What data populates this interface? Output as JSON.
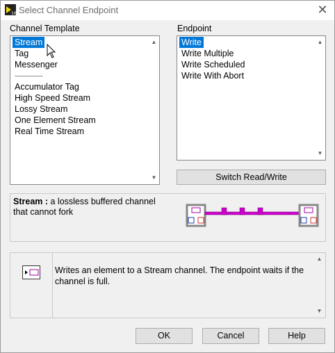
{
  "window": {
    "title": "Select Channel Endpoint",
    "close_glyph": "✕"
  },
  "template": {
    "label": "Channel Template",
    "items": [
      {
        "label": "Stream",
        "selected": true
      },
      {
        "label": "Tag"
      },
      {
        "label": "Messenger"
      },
      {
        "label": "-----------",
        "separator": true
      },
      {
        "label": "Accumulator Tag"
      },
      {
        "label": "High Speed Stream"
      },
      {
        "label": "Lossy Stream"
      },
      {
        "label": "One Element Stream"
      },
      {
        "label": "Real Time Stream"
      }
    ]
  },
  "endpoint": {
    "label": "Endpoint",
    "items": [
      {
        "label": "Write",
        "selected": true
      },
      {
        "label": "Write Multiple"
      },
      {
        "label": "Write Scheduled"
      },
      {
        "label": "Write With Abort"
      }
    ]
  },
  "switch_button": "Switch Read/Write",
  "description": {
    "name": "Stream :",
    "text": " a lossless buffered channel that cannot fork"
  },
  "help": {
    "text": "Writes an element to a Stream channel. The endpoint waits if the channel is full."
  },
  "buttons": {
    "ok": "OK",
    "cancel": "Cancel",
    "help": "Help"
  },
  "icons": {
    "app": "labview-icon",
    "scroll_up": "▲",
    "scroll_down": "▼"
  },
  "colors": {
    "selection": "#0078d7",
    "wire": "#cc00cc",
    "terminal_blue": "#1a3fb0",
    "terminal_red": "#d32f2f"
  }
}
